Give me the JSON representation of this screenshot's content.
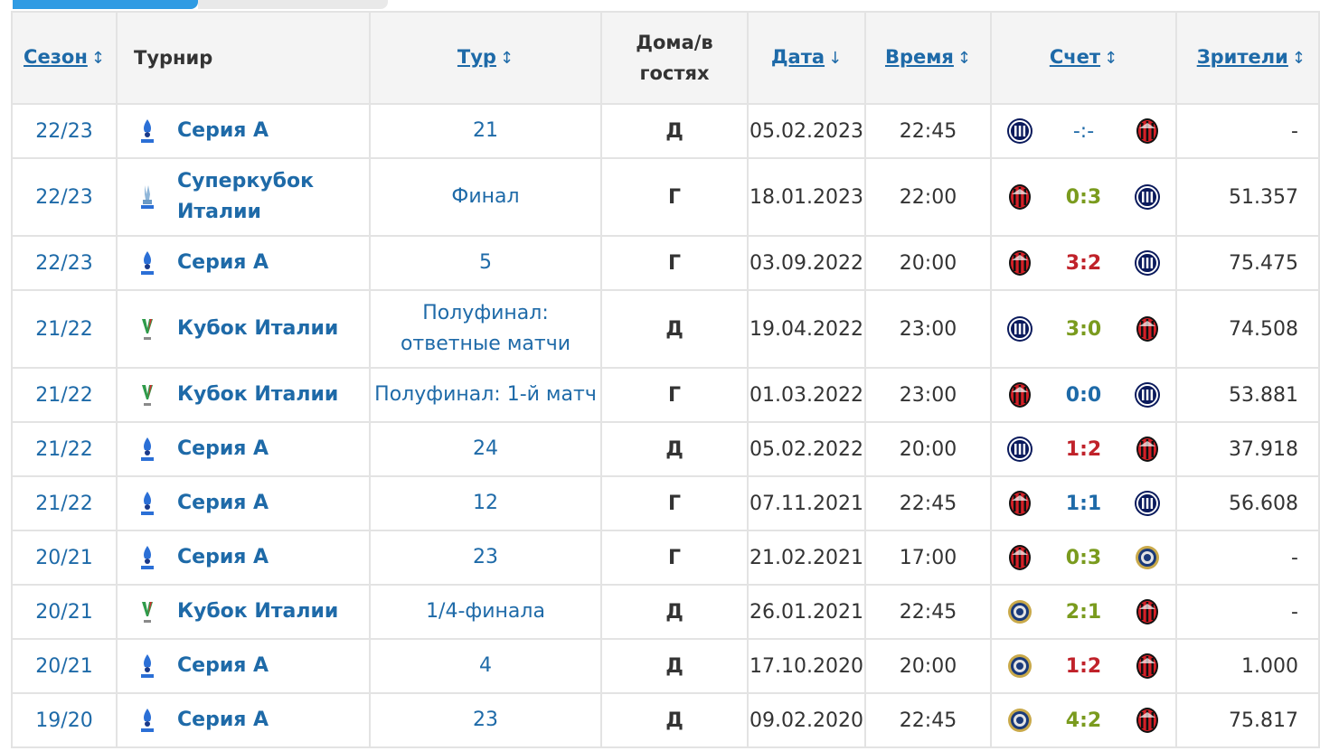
{
  "colors": {
    "win": "#7a9b1e",
    "lose": "#c0222a",
    "draw": "#1e6aa8",
    "link": "#1e6aa8",
    "accent_tab": "#2f9be3"
  },
  "headers": {
    "season": "Сезон",
    "tournament": "Турнир",
    "round": "Тур",
    "home_away": "Дома/в гостях",
    "date": "Дата",
    "time": "Время",
    "score": "Счет",
    "spectators": "Зрители"
  },
  "sort_icons": {
    "unsorted": "↕",
    "desc": "↓"
  },
  "rows": [
    {
      "season": "22/23",
      "tournament": "Серия А",
      "logo": "serie-a-icon",
      "round": "21",
      "ha": "Д",
      "date": "05.02.2023",
      "time": "22:45",
      "home": "inter-badge-icon",
      "score": "-:-",
      "result": "none",
      "away": "milan-badge-icon",
      "att": "-"
    },
    {
      "season": "22/23",
      "tournament": "Суперкубок Италии",
      "logo": "supercoppa-icon",
      "round": "Финал",
      "ha": "Г",
      "date": "18.01.2023",
      "time": "22:00",
      "home": "milan-badge-icon",
      "score": "0:3",
      "result": "win",
      "away": "inter-badge-icon",
      "att": "51.357"
    },
    {
      "season": "22/23",
      "tournament": "Серия А",
      "logo": "serie-a-icon",
      "round": "5",
      "ha": "Г",
      "date": "03.09.2022",
      "time": "20:00",
      "home": "milan-badge-icon",
      "score": "3:2",
      "result": "lose",
      "away": "inter-badge-icon",
      "att": "75.475"
    },
    {
      "season": "21/22",
      "tournament": "Кубок Италии",
      "logo": "coppa-italia-icon",
      "round": "Полуфинал: ответные матчи",
      "ha": "Д",
      "date": "19.04.2022",
      "time": "23:00",
      "home": "inter-badge-icon",
      "score": "3:0",
      "result": "win",
      "away": "milan-badge-icon",
      "att": "74.508"
    },
    {
      "season": "21/22",
      "tournament": "Кубок Италии",
      "logo": "coppa-italia-icon",
      "round": "Полуфинал: 1-й матч",
      "ha": "Г",
      "date": "01.03.2022",
      "time": "23:00",
      "home": "milan-badge-icon",
      "score": "0:0",
      "result": "draw",
      "away": "inter-badge-icon",
      "att": "53.881"
    },
    {
      "season": "21/22",
      "tournament": "Серия А",
      "logo": "serie-a-icon",
      "round": "24",
      "ha": "Д",
      "date": "05.02.2022",
      "time": "20:00",
      "home": "inter-badge-icon",
      "score": "1:2",
      "result": "lose",
      "away": "milan-badge-icon",
      "att": "37.918"
    },
    {
      "season": "21/22",
      "tournament": "Серия А",
      "logo": "serie-a-icon",
      "round": "12",
      "ha": "Г",
      "date": "07.11.2021",
      "time": "22:45",
      "home": "milan-badge-icon",
      "score": "1:1",
      "result": "draw",
      "away": "inter-badge-icon",
      "att": "56.608"
    },
    {
      "season": "20/21",
      "tournament": "Серия А",
      "logo": "serie-a-icon",
      "round": "23",
      "ha": "Г",
      "date": "21.02.2021",
      "time": "17:00",
      "home": "milan-badge-icon",
      "score": "0:3",
      "result": "win",
      "away": "inter-old-badge-icon",
      "att": "-"
    },
    {
      "season": "20/21",
      "tournament": "Кубок Италии",
      "logo": "coppa-italia-icon",
      "round": "1/4-финала",
      "ha": "Д",
      "date": "26.01.2021",
      "time": "22:45",
      "home": "inter-old-badge-icon",
      "score": "2:1",
      "result": "win",
      "away": "milan-badge-icon",
      "att": "-"
    },
    {
      "season": "20/21",
      "tournament": "Серия А",
      "logo": "serie-a-icon",
      "round": "4",
      "ha": "Д",
      "date": "17.10.2020",
      "time": "20:00",
      "home": "inter-old-badge-icon",
      "score": "1:2",
      "result": "lose",
      "away": "milan-badge-icon",
      "att": "1.000"
    },
    {
      "season": "19/20",
      "tournament": "Серия А",
      "logo": "serie-a-icon",
      "round": "23",
      "ha": "Д",
      "date": "09.02.2020",
      "time": "22:45",
      "home": "inter-old-badge-icon",
      "score": "4:2",
      "result": "win",
      "away": "milan-badge-icon",
      "att": "75.817"
    }
  ]
}
